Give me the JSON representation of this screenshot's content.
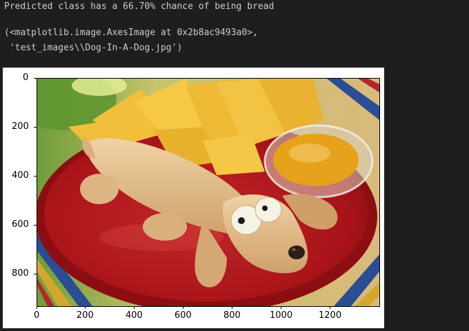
{
  "output": {
    "prediction_text": "Predicted class has a 66.70% chance of being bread",
    "repr_line_1": "(<matplotlib.image.AxesImage at 0x2b8ac9493a0>,",
    "repr_line_2": " 'test_images\\\\Dog-In-A-Dog.jpg')"
  },
  "chart_data": {
    "type": "image",
    "title": "",
    "xlabel": "",
    "ylabel": "",
    "xlim": [
      0,
      1400
    ],
    "ylim": [
      930,
      0
    ],
    "x_ticks": [
      "0",
      "200",
      "400",
      "600",
      "800",
      "1000",
      "1200"
    ],
    "y_ticks": [
      "0",
      "200",
      "400",
      "600",
      "800"
    ]
  },
  "image": {
    "description_icon": "dog-in-a-dog-photo"
  },
  "colors": {
    "background": "#1e1e1e",
    "text": "#cccccc",
    "figure_bg": "#ffffff",
    "plate": "#b3181d",
    "bread": "#e2bf8e",
    "chips": "#f1bf3c",
    "sauce": "#e6a21a"
  }
}
